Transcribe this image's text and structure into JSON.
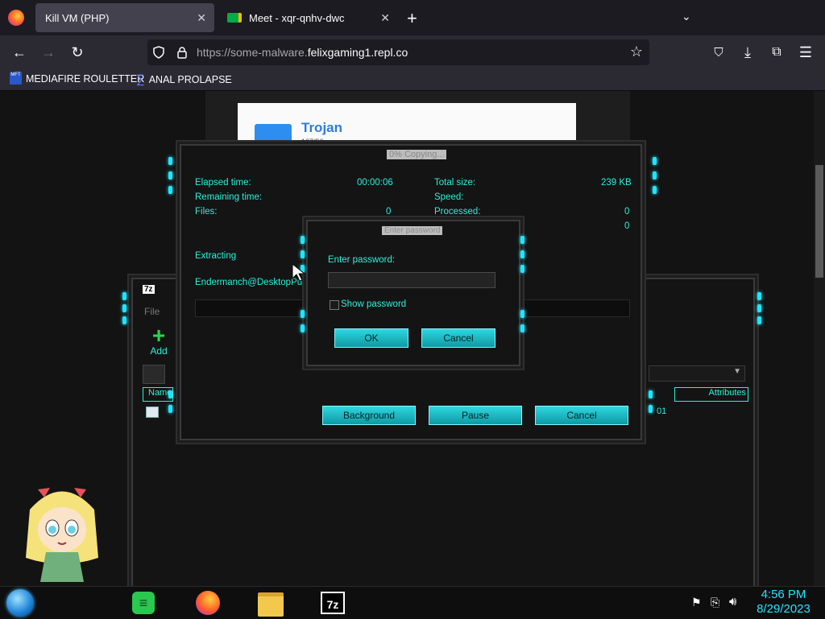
{
  "browser": {
    "tabs": [
      {
        "title": "Kill VM (PHP)",
        "active": true
      },
      {
        "title": "Meet - xqr-qnhv-dwc",
        "active": false
      }
    ],
    "new_tab": "+",
    "url_prefix": "https://some-malware.",
    "url_domain": "felixgaming1.repl.co",
    "bookmarks": [
      {
        "icon_text": "MFT",
        "label": "MEDIAFIRE ROULETTER"
      },
      {
        "label": "ANAL PROLAPSE"
      }
    ]
  },
  "background_page": {
    "folder_title": "Trojan",
    "folder_subtitle": "107/56"
  },
  "filemanager": {
    "logo": "7z",
    "menu_file": "File",
    "add_label": "Add",
    "col_name": "Name",
    "col_attributes": "Attributes",
    "row_fragment": "01"
  },
  "copy_dialog": {
    "title": "0% Copying...",
    "elapsed_label": "Elapsed time:",
    "elapsed_value": "00:00:06",
    "remaining_label": "Remaining time:",
    "files_label": "Files:",
    "files_value": "0",
    "total_size_label": "Total size:",
    "total_size_value": "239 KB",
    "speed_label": "Speed:",
    "processed_label": "Processed:",
    "processed_value": "0",
    "extra_value": "0",
    "extracting_label": "Extracting",
    "path_text": "Endermanch@DesktopPu...",
    "background_button": "Background",
    "pause_button": "Pause",
    "cancel_button": "Cancel"
  },
  "password_dialog": {
    "title": "Enter password",
    "prompt": "Enter password:",
    "show_password_label": "Show password",
    "show_password_checked": false,
    "ok_button": "OK",
    "cancel_button": "Cancel"
  },
  "taskbar": {
    "time": "4:56 PM",
    "date": "8/29/2023",
    "app_7z_label": "7z"
  },
  "colors": {
    "accent": "#1ee6ff",
    "label_text": "#2af0d8",
    "browser_bg": "#2b2a33"
  }
}
